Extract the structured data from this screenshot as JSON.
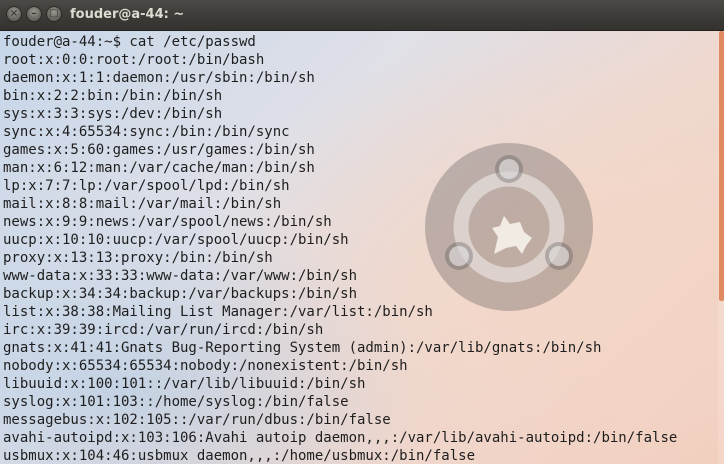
{
  "window": {
    "title": "fouder@a-44: ~",
    "close_glyph": "×",
    "minimize_glyph": "–",
    "maximize_glyph": "□"
  },
  "terminal": {
    "background_gradient": [
      "#c6d6e9",
      "#efd8cf",
      "#f2cfbf"
    ],
    "text_color": "#1e1e1e",
    "scrollbar_color": "#e08a62",
    "lines": [
      "fouder@a-44:~$ cat /etc/passwd",
      "root:x:0:0:root:/root:/bin/bash",
      "daemon:x:1:1:daemon:/usr/sbin:/bin/sh",
      "bin:x:2:2:bin:/bin:/bin/sh",
      "sys:x:3:3:sys:/dev:/bin/sh",
      "sync:x:4:65534:sync:/bin:/bin/sync",
      "games:x:5:60:games:/usr/games:/bin/sh",
      "man:x:6:12:man:/var/cache/man:/bin/sh",
      "lp:x:7:7:lp:/var/spool/lpd:/bin/sh",
      "mail:x:8:8:mail:/var/mail:/bin/sh",
      "news:x:9:9:news:/var/spool/news:/bin/sh",
      "uucp:x:10:10:uucp:/var/spool/uucp:/bin/sh",
      "proxy:x:13:13:proxy:/bin:/bin/sh",
      "www-data:x:33:33:www-data:/var/www:/bin/sh",
      "backup:x:34:34:backup:/var/backups:/bin/sh",
      "list:x:38:38:Mailing List Manager:/var/list:/bin/sh",
      "irc:x:39:39:ircd:/var/run/ircd:/bin/sh",
      "gnats:x:41:41:Gnats Bug-Reporting System (admin):/var/lib/gnats:/bin/sh",
      "nobody:x:65534:65534:nobody:/nonexistent:/bin/sh",
      "libuuid:x:100:101::/var/lib/libuuid:/bin/sh",
      "syslog:x:101:103::/home/syslog:/bin/false",
      "messagebus:x:102:105::/var/run/dbus:/bin/false",
      "avahi-autoipd:x:103:106:Avahi autoip daemon,,,:/var/lib/avahi-autoipd:/bin/false",
      "usbmux:x:104:46:usbmux daemon,,,:/home/usbmux:/bin/false"
    ]
  }
}
